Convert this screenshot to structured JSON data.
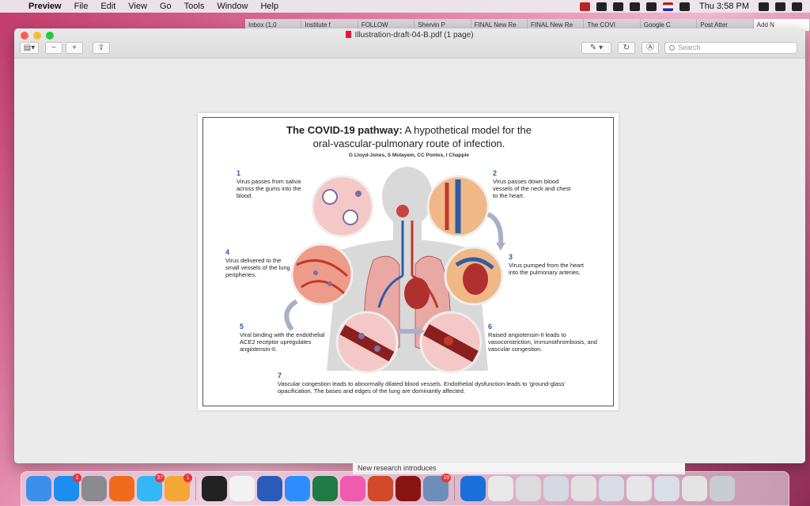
{
  "menubar": {
    "app_name": "Preview",
    "items": [
      "File",
      "Edit",
      "View",
      "Go",
      "Tools",
      "Window",
      "Help"
    ],
    "clock": "Thu 3:58 PM"
  },
  "browser_tabs": [
    "Inbox (1,0",
    "Institute f",
    "FOLLOW",
    "Shervin P",
    "FINAL New Re",
    "FINAL New Re",
    "The COVI",
    "Google C",
    "Post Atter",
    "Add N"
  ],
  "window": {
    "title": "Illustration-draft-04-B.pdf (1 page)",
    "search_placeholder": "Search"
  },
  "figure": {
    "title_bold": "The COVID-19 pathway:",
    "title_rest": " A hypothetical model for the",
    "title_line2": "oral-vascular-pulmonary route of infection.",
    "authors": "G Lloyd-Jones, S Molayem, CC Pontes, I Chapple",
    "steps": [
      {
        "num": "1",
        "text": "Virus passes from saliva across the gums into the blood."
      },
      {
        "num": "2",
        "text": "Virus passes down blood vessels of the neck and chest to the heart."
      },
      {
        "num": "3",
        "text": "Virus pumped from the heart into the pulmonary arteries."
      },
      {
        "num": "4",
        "text": "Virus delivered to the small vessels of the lung peripheries."
      },
      {
        "num": "5",
        "text": "Viral binding with the endothelial ACE2 receptor upregulates angiotensin-II."
      },
      {
        "num": "6",
        "text": "Raised angiotensin-II leads to vasoconstriction, immunothrombosis, and vascular congestion."
      },
      {
        "num": "7",
        "text": "Vascular congestion leads to abnormally dilated blood vessels. Endothelial dysfunction leads to 'ground-glass' opacification. The bases and edges of the lung are dominantly affected."
      }
    ]
  },
  "bottom_peek_text": "New research introduces",
  "dock": {
    "items": [
      {
        "icon": "finder-icon",
        "color": "#3b8fe8",
        "badge": ""
      },
      {
        "icon": "app-store-icon",
        "color": "#1c8ef0",
        "badge": "1"
      },
      {
        "icon": "system-preferences-icon",
        "color": "#8a8a8f",
        "badge": ""
      },
      {
        "icon": "firefox-icon",
        "color": "#f06a1c",
        "badge": ""
      },
      {
        "icon": "messages-icon",
        "color": "#35b6f5",
        "badge": "37"
      },
      {
        "icon": "photos-icon",
        "color": "#f4a637",
        "badge": "1"
      },
      {
        "icon": "terminal-icon",
        "color": "#222222",
        "badge": ""
      },
      {
        "icon": "textedit-icon",
        "color": "#f2f2f2",
        "badge": ""
      },
      {
        "icon": "word-icon",
        "color": "#2b5bb8",
        "badge": ""
      },
      {
        "icon": "zoom-icon",
        "color": "#2d8cff",
        "badge": ""
      },
      {
        "icon": "excel-icon",
        "color": "#1f7a44",
        "badge": ""
      },
      {
        "icon": "itunes-icon",
        "color": "#f05ab0",
        "badge": ""
      },
      {
        "icon": "powerpoint-icon",
        "color": "#d04a2a",
        "badge": ""
      },
      {
        "icon": "flash-icon",
        "color": "#8a1414",
        "badge": ""
      },
      {
        "icon": "preview-icon",
        "color": "#6b8fb8",
        "badge": "19"
      },
      {
        "icon": "1password-icon",
        "color": "#1a6fd8",
        "badge": ""
      },
      {
        "icon": "document-thumb-icon",
        "color": "#e8e8e8",
        "badge": ""
      },
      {
        "icon": "document-thumb-icon",
        "color": "#dcdcdc",
        "badge": ""
      },
      {
        "icon": "document-thumb-icon",
        "color": "#d4d9e2",
        "badge": ""
      },
      {
        "icon": "document-thumb-icon",
        "color": "#e2e2e2",
        "badge": ""
      },
      {
        "icon": "document-thumb-icon",
        "color": "#d7dce6",
        "badge": ""
      },
      {
        "icon": "document-thumb-icon",
        "color": "#e6e6e6",
        "badge": ""
      },
      {
        "icon": "document-thumb-icon",
        "color": "#d9dee8",
        "badge": ""
      },
      {
        "icon": "document-thumb-icon",
        "color": "#e4e4e4",
        "badge": ""
      },
      {
        "icon": "trash-icon",
        "color": "#c9cdd2",
        "badge": ""
      }
    ]
  }
}
